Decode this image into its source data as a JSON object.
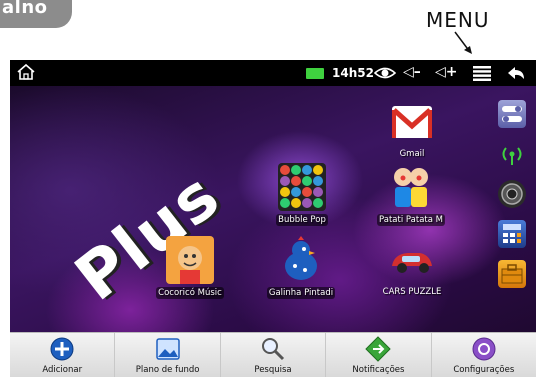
{
  "brand": {
    "tab_label": "alno"
  },
  "callout": {
    "menu_label": "MENU"
  },
  "status_bar": {
    "time": "14h52",
    "icons": [
      "home-icon",
      "battery-icon",
      "eye-icon",
      "volume-down-icon",
      "volume-up-icon",
      "menu-icon",
      "back-icon"
    ],
    "volume_down_label": "◁–",
    "volume_up_label": "◁+"
  },
  "wallpaper": {
    "text": "Plus"
  },
  "apps": [
    {
      "label": "Gmail",
      "icon": "gmail-icon"
    },
    {
      "label": "Bubble Pop",
      "icon": "bubble-pop-icon"
    },
    {
      "label": "Patati Patata M",
      "icon": "clowns-icon"
    },
    {
      "label": "Cocoricó Músic",
      "icon": "cocorico-icon"
    },
    {
      "label": "Galinha Pintadi",
      "icon": "galinha-icon"
    },
    {
      "label": "CARS PUZZLE",
      "icon": "car-icon"
    }
  ],
  "dock": [
    "settings-switch-icon",
    "wifi-icon",
    "camera-icon",
    "calculator-icon",
    "toolbox-icon"
  ],
  "bottom_menu": {
    "items": [
      {
        "label": "Adicionar",
        "icon": "add-icon"
      },
      {
        "label": "Plano de fundo",
        "icon": "wallpaper-icon"
      },
      {
        "label": "Pesquisa",
        "icon": "search-icon"
      },
      {
        "label": "Notificações",
        "icon": "notification-icon"
      },
      {
        "label": "Configurações",
        "icon": "settings-icon"
      }
    ]
  },
  "colors": {
    "battery": "#3fd13f",
    "menu_bar_top": "#f4f4f4",
    "menu_bar_bottom": "#d9d9d9",
    "add_button": "#1e5fbf",
    "notification": "#3aa53a",
    "settings": "#8a4fc7"
  }
}
